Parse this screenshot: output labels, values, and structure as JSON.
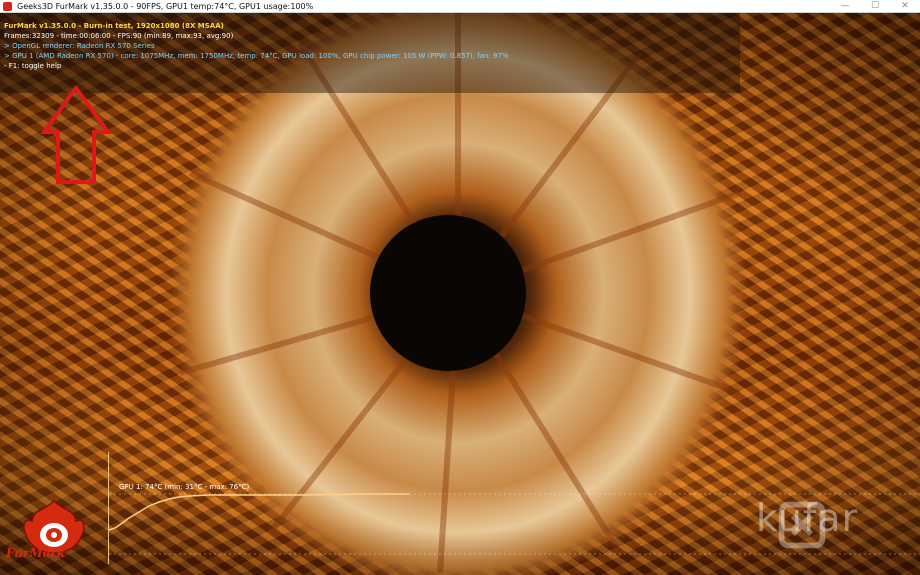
{
  "window": {
    "title": "Geeks3D FurMark v1.35.0.0 - 90FPS, GPU1 temp:74°C, GPU1 usage:100%",
    "minimize": "—",
    "maximize": "☐",
    "close": "✕"
  },
  "osd": {
    "line1": "FurMark v1.35.0.0 - Burn-in test, 1920x1080 (8X MSAA)",
    "line2": "Frames:32309 - time:00:06:00 - FPS:90 (min:89, max:93, avg:90)",
    "line3": "> OpenGL renderer: Radeon RX 570 Series",
    "line4": "> GPU 1 (AMD Radeon RX 570) - core: 1075MHz, mem: 1750MHz, temp: 74°C, GPU load: 100%, GPU chip power: 105 W (PPW: 0.857), fan: 97%",
    "line5": "- F1: toggle help"
  },
  "graph": {
    "label": "GPU 1: 74°C (min: 31°C - max: 76°C)",
    "line_color": "#ffcf8a"
  },
  "logo": {
    "text": "FurMark"
  },
  "watermark": {
    "text": "kufar"
  },
  "colors": {
    "osd_yellow": "#ffd54a",
    "osd_cyan": "#7fd3ff",
    "arrow": "#e01818"
  }
}
